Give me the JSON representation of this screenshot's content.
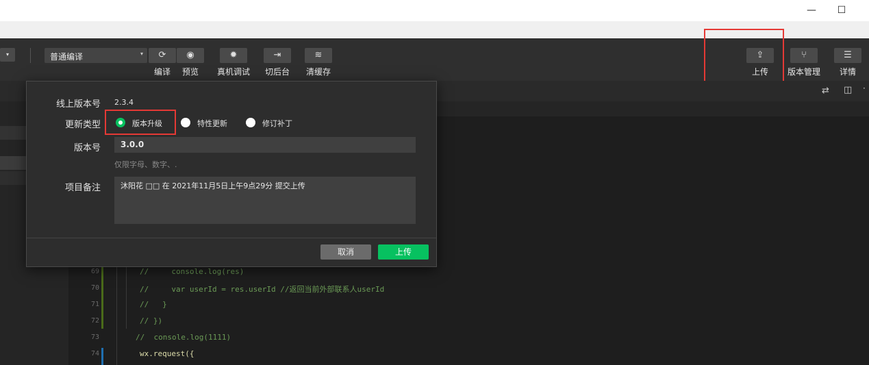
{
  "window": {
    "minimize_glyph": "—",
    "maximize_glyph": "☐"
  },
  "toolbar": {
    "compile_mode": "普通编译",
    "compile_label": "编译",
    "preview_label": "预览",
    "remote_debug_label": "真机调试",
    "background_label": "切后台",
    "clear_cache_label": "清缓存",
    "upload_label": "上传",
    "version_mgmt_label": "版本管理",
    "details_label": "详情"
  },
  "dialog": {
    "online_version_label": "线上版本号",
    "online_version_value": "2.3.4",
    "update_type_label": "更新类型",
    "update_types": [
      "版本升级",
      "特性更新",
      "修订补丁"
    ],
    "selected_update_type": "版本升级",
    "version_label": "版本号",
    "version_value": "3.0.0",
    "version_hint": "仅限字母、数字、.",
    "remark_label": "项目备注",
    "remark_value": "沐阳花 □□ 在 2021年11月5日上午9点29分 提交上传",
    "cancel_label": "取消",
    "upload_label": "上传"
  },
  "editor": {
    "lines": [
      {
        "number": "69",
        "code": "//     console.log(res)"
      },
      {
        "number": "70",
        "code": "//     var userId = res.userId //返回当前外部联系人userId"
      },
      {
        "number": "71",
        "code": "//   }"
      },
      {
        "number": "72",
        "code": "// })"
      },
      {
        "number": "73",
        "code": "//  console.log(1111)"
      },
      {
        "number": "74",
        "code": "wx.request({"
      }
    ]
  },
  "colors": {
    "primary_green": "#07c160",
    "highlight_red": "#e53935"
  }
}
